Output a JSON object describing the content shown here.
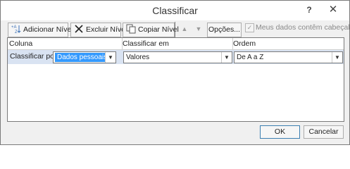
{
  "window": {
    "title": "Classificar",
    "help_label": "?",
    "close_label": "✕"
  },
  "toolbar": {
    "add_level": "Adicionar Nível",
    "delete_level": "Excluir Nível",
    "copy_level": "Copiar Nível",
    "move_up": "▲",
    "move_down": "▼",
    "options": "Opções...",
    "headers_checkbox_label": "Meus dados contêm cabeçalhos",
    "headers_checked": true
  },
  "grid": {
    "headers": [
      "Coluna",
      "Classificar em",
      "Ordem"
    ],
    "rows": [
      {
        "label": "Classificar por",
        "column": "Dados pessoais",
        "sort_on": "Valores",
        "order": "De A a Z"
      }
    ]
  },
  "footer": {
    "ok": "OK",
    "cancel": "Cancelar"
  },
  "colors": {
    "selected_row": "#d9e3f2",
    "highlight": "#3399ff",
    "ok_border": "#3c7fb1"
  }
}
